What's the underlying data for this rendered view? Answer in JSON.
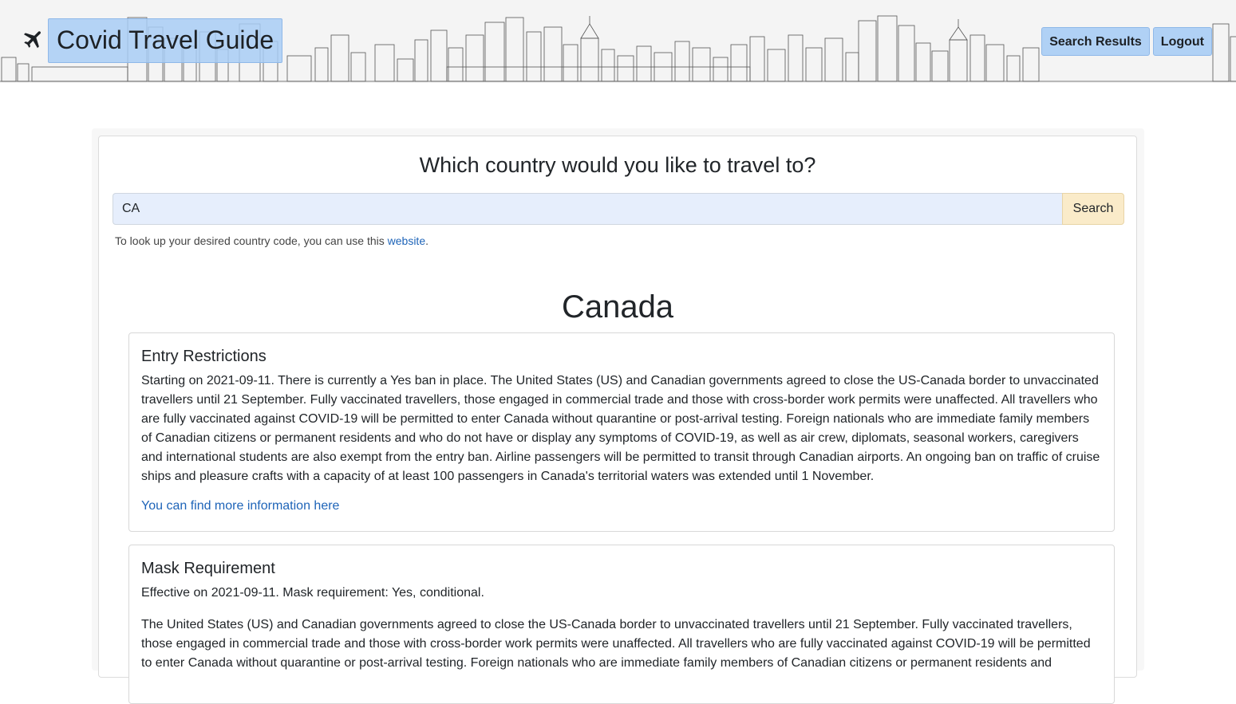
{
  "header": {
    "brand_title": "Covid Travel Guide",
    "nav": {
      "search_results": "Search Results",
      "logout": "Logout"
    }
  },
  "search": {
    "question": "Which country would you like to travel to?",
    "input_value": "CA",
    "button_label": "Search",
    "help_prefix": "To look up your desired country code, you can use this ",
    "help_link": "website",
    "help_suffix": "."
  },
  "country": {
    "name": "Canada",
    "entry": {
      "heading": "Entry Restrictions",
      "body": "Starting on 2021-09-11. There is currently a Yes ban in place. The United States (US) and Canadian governments agreed to close the US-Canada border to unvaccinated travellers until 21 September. Fully vaccinated travellers, those engaged in commercial trade and those with cross-border work permits were unaffected. All travellers who are fully vaccinated against COVID-19 will be permitted to enter Canada without quarantine or post-arrival testing. Foreign nationals who are immediate family members of Canadian citizens or permanent residents and who do not have or display any symptoms of COVID-19, as well as air crew, diplomats, seasonal workers, caregivers and international students are also exempt from the entry ban. Airline passengers will be permitted to transit through Canadian airports. An ongoing ban on traffic of cruise ships and pleasure crafts with a capacity of at least 100 passengers in Canada's territorial waters was extended until 1 November.",
      "link": "You can find more information here"
    },
    "mask": {
      "heading": "Mask Requirement",
      "body1": "Effective on 2021-09-11. Mask requirement: Yes, conditional.",
      "body2": "The United States (US) and Canadian governments agreed to close the US-Canada border to unvaccinated travellers until 21 September. Fully vaccinated travellers, those engaged in commercial trade and those with cross-border work permits were unaffected. All travellers who are fully vaccinated against COVID-19 will be permitted to enter Canada without quarantine or post-arrival testing. Foreign nationals who are immediate family members of Canadian citizens or permanent residents and"
    }
  },
  "colors": {
    "brand_highlight": "#a8cdf5",
    "search_input_bg": "#e6eefc",
    "search_button_bg": "#faebc9",
    "link": "#1e64b8"
  },
  "icons": {
    "brand": "airplane-icon",
    "header_art": "city-skyline-illustration"
  }
}
